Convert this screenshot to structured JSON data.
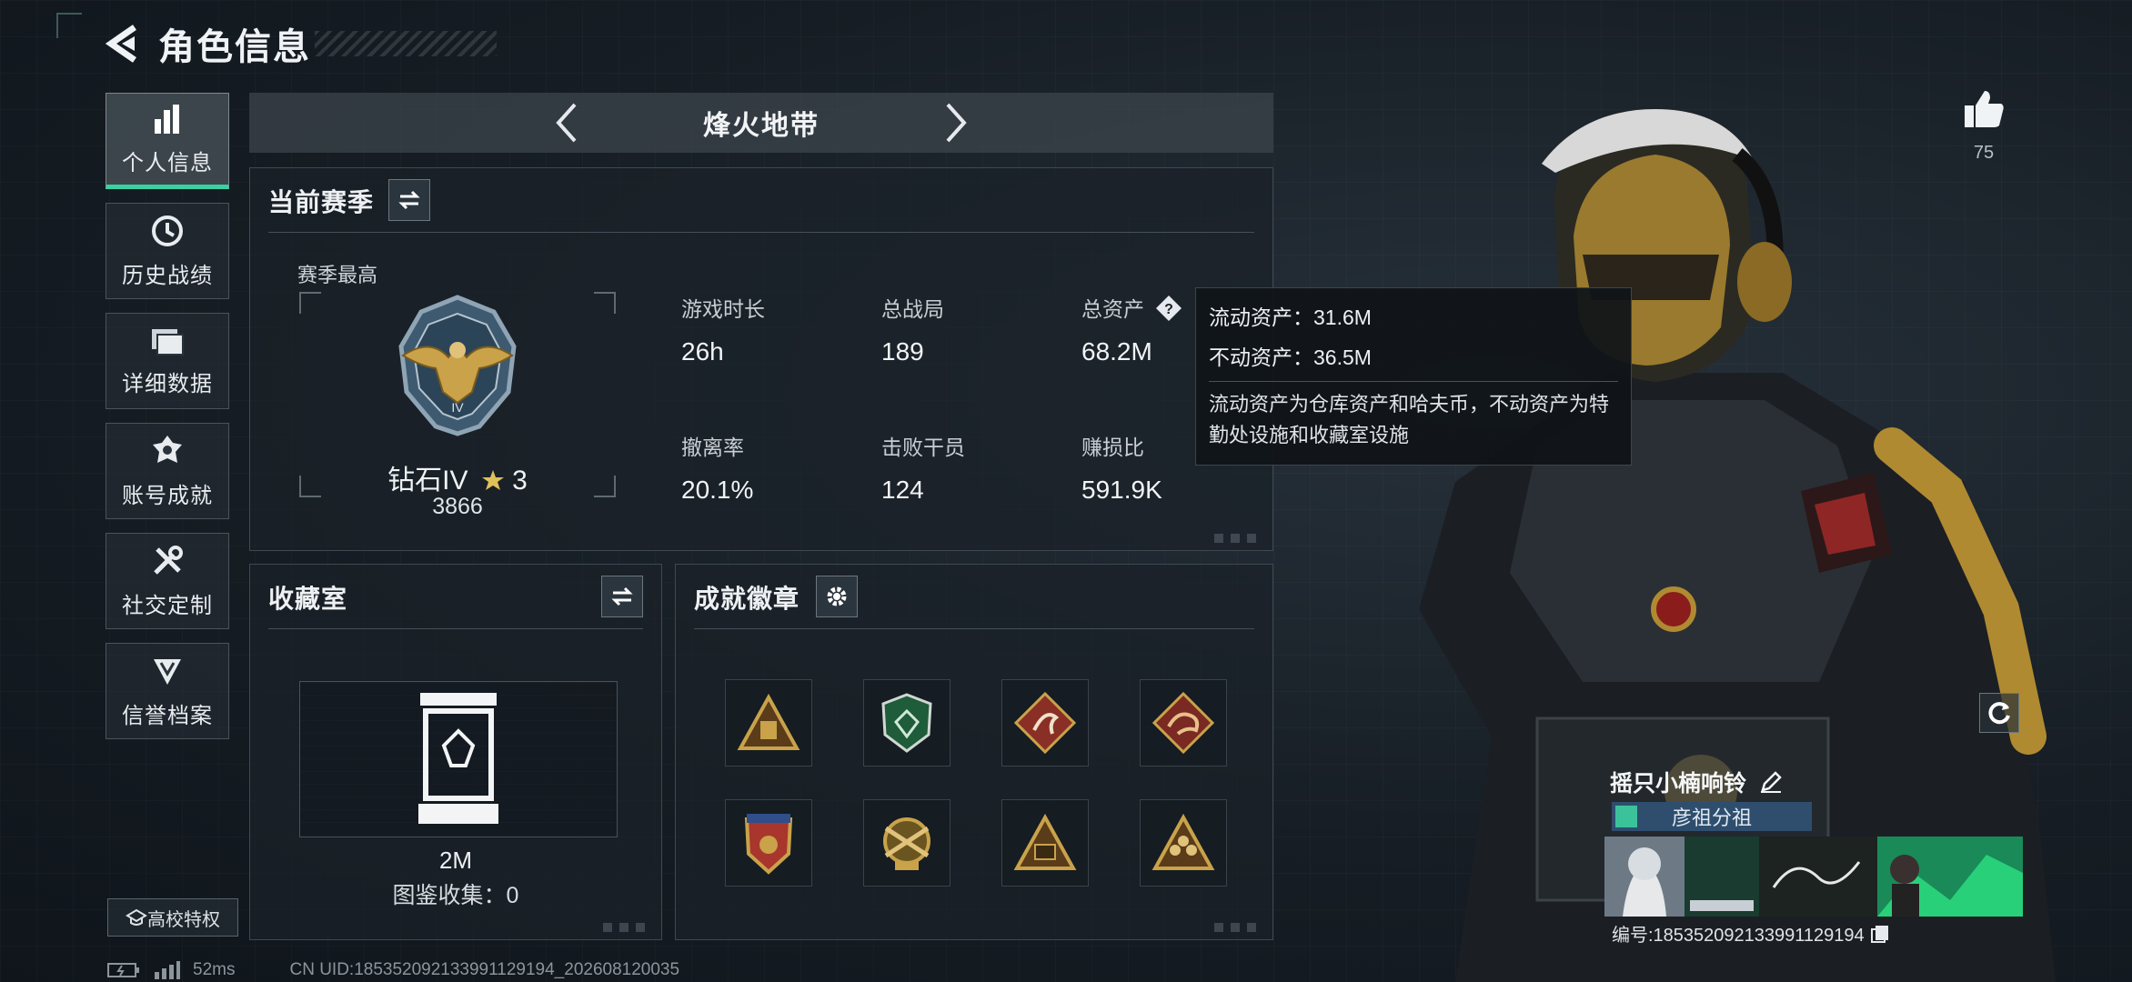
{
  "header": {
    "title": "角色信息"
  },
  "nav": {
    "items": [
      {
        "label": "个人信息",
        "icon": "bar-chart-icon",
        "active": true
      },
      {
        "label": "历史战绩",
        "icon": "clock-icon"
      },
      {
        "label": "详细数据",
        "icon": "folder-icon"
      },
      {
        "label": "账号成就",
        "icon": "achievement-icon"
      },
      {
        "label": "社交定制",
        "icon": "tools-icon"
      },
      {
        "label": "信誉档案",
        "icon": "shield-icon"
      }
    ],
    "school_label": "高校特权"
  },
  "mode": {
    "title": "烽火地带"
  },
  "season": {
    "title": "当前赛季",
    "best_label": "赛季最高",
    "rank_name": "钻石IV",
    "rank_stars": "3",
    "rank_score": "3866",
    "stats": [
      {
        "label": "游戏时长",
        "value": "26h"
      },
      {
        "label": "总战局",
        "value": "189"
      },
      {
        "label": "总资产",
        "value": "68.2M"
      },
      {
        "label": "撤离率",
        "value": "20.1%"
      },
      {
        "label": "击败干员",
        "value": "124"
      },
      {
        "label": "赚损比",
        "value": "591.9K"
      }
    ]
  },
  "tooltip": {
    "liquid": "流动资产：31.6M",
    "fixed": "不动资产：36.5M",
    "desc": "流动资产为仓库资产和哈夫币，不动资产为特勤处设施和收藏室设施"
  },
  "collection": {
    "title": "收藏室",
    "value": "2M",
    "count": "图鉴收集：0"
  },
  "badges": {
    "title": "成就徽章"
  },
  "profile": {
    "likes": "75",
    "player_name": "摇只小楠响铃",
    "guild": "彦祖分祖",
    "card_id": "编号:18535209213399112919​4"
  },
  "footer": {
    "ping": "52ms",
    "uid": "CN UID:18535209213399112919​4_202608120035"
  },
  "colors": {
    "accent": "#3ad0a0",
    "badge_gold": "#c9a24a",
    "badge_red": "#a8362c"
  }
}
